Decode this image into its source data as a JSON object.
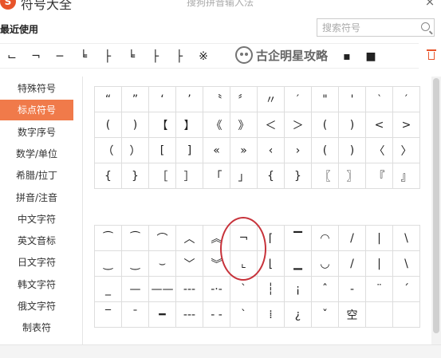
{
  "window": {
    "logo_text": "S",
    "title": "符号大全",
    "subtitle": "搜狗拼音输入法",
    "close_glyph": "×"
  },
  "recent": {
    "label": "最近使用",
    "items": [
      "⌙",
      "¬",
      "─",
      "╘",
      "├",
      "╘",
      "├",
      "├",
      "※",
      "",
      "",
      "",
      "",
      "",
      "▪",
      "■"
    ]
  },
  "search": {
    "placeholder": "搜索符号"
  },
  "watermark": {
    "text": "古企明星攻略"
  },
  "sidebar": {
    "items": [
      {
        "label": "特殊符号"
      },
      {
        "label": "标点符号"
      },
      {
        "label": "数字序号"
      },
      {
        "label": "数学/单位"
      },
      {
        "label": "希腊/拉丁"
      },
      {
        "label": "拼音/注音"
      },
      {
        "label": "中文字符"
      },
      {
        "label": "英文音标"
      },
      {
        "label": "日文字符"
      },
      {
        "label": "韩文字符"
      },
      {
        "label": "俄文字符"
      },
      {
        "label": "制表符"
      }
    ],
    "active_index": 1
  },
  "grid_top": [
    [
      "“",
      "”",
      "‘",
      "’",
      "〝",
      "〞",
      "〃",
      "′",
      "\"",
      "'",
      "‵",
      "′"
    ],
    [
      "(",
      ")",
      "【",
      "】",
      "《",
      "》",
      "＜",
      "＞",
      "(",
      ")",
      "<",
      ">"
    ],
    [
      "（",
      "）",
      "[",
      "]",
      "«",
      "»",
      "‹",
      "›",
      "(",
      ")",
      "〈",
      "〉"
    ],
    [
      "{",
      "}",
      "［",
      "］",
      "「",
      "」",
      "{",
      "}",
      "〖",
      "〗",
      "『",
      "』"
    ]
  ],
  "grid_bottom": [
    [
      "⁀",
      "⁀",
      "⌒",
      "︿",
      "︽",
      "¬",
      "⌈",
      "▔",
      "◠",
      "/",
      "|",
      "\\"
    ],
    [
      "‿",
      "‿",
      "⌣",
      "﹀",
      "︾",
      "⌞",
      "⌊",
      "▁",
      "◡",
      "/",
      "|",
      "\\"
    ],
    [
      "_",
      "—",
      "——",
      "---",
      "-·-",
      "ˋ",
      "┆",
      "¡",
      "ˆ",
      "-",
      "¨",
      "ˊ"
    ],
    [
      "‾",
      "¯",
      "━",
      "---",
      "- -",
      "ˋ",
      "⁞",
      "¿",
      "ˇ",
      "空",
      "",
      ""
    ]
  ]
}
